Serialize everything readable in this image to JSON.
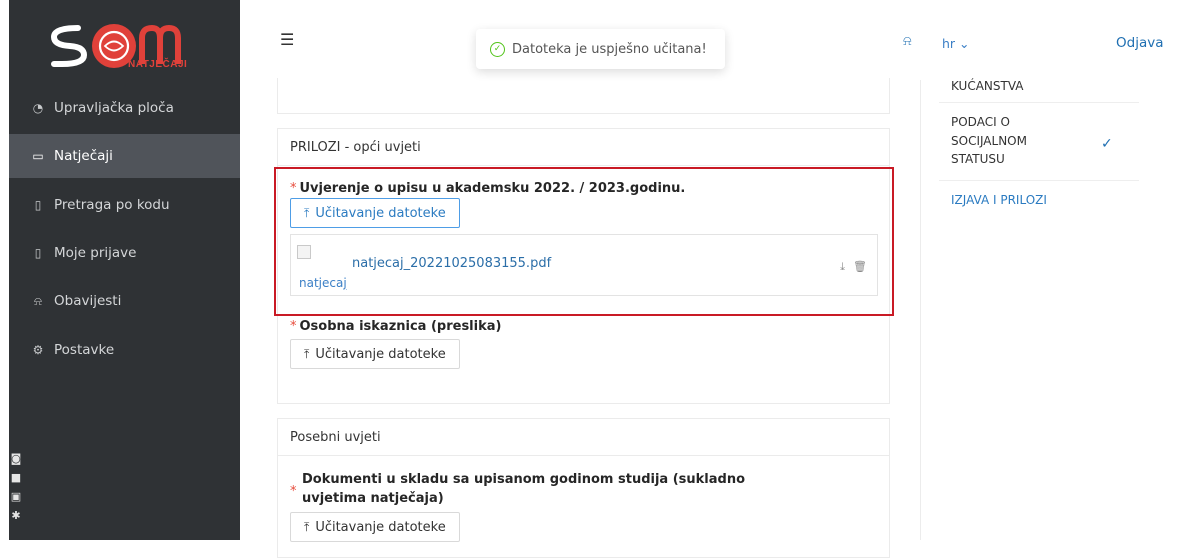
{
  "brand": {
    "logo_text": "SOM",
    "logo_sub": "NATJEČAJI",
    "colors": {
      "accent": "#e0413a",
      "sidebar": "#2f3235",
      "link": "#2b7bc1"
    }
  },
  "sidebar": {
    "items": [
      {
        "label": "Upravljačka ploča",
        "icon": "dashboard-icon"
      },
      {
        "label": "Natječaji",
        "icon": "folder-open-icon",
        "active": true
      },
      {
        "label": "Pretraga po kodu",
        "icon": "file-icon"
      },
      {
        "label": "Moje prijave",
        "icon": "file-icon"
      },
      {
        "label": "Obavijesti",
        "icon": "bell-icon"
      },
      {
        "label": "Postavke",
        "icon": "gear-icon"
      }
    ]
  },
  "topbar": {
    "language": "hr",
    "logout_label": "Odjava"
  },
  "toast": {
    "message": "Datoteka je uspješno učitana!"
  },
  "sections": [
    {
      "title": "PRILOZI - opći uvjeti",
      "fields": [
        {
          "label": "Uvjerenje o upisu u akademsku 2022. / 2023.godinu.",
          "upload_label": "Učitavanje datoteke",
          "file": {
            "name": "natjecaj_20221025083155.pdf",
            "thumb_alt": "natjecaj_20221025083155.pdf"
          }
        },
        {
          "label": "Osobna iskaznica (preslika)",
          "upload_label": "Učitavanje datoteke"
        }
      ]
    },
    {
      "title": "Posebni uvjeti",
      "fields": [
        {
          "label_line1": "Dokumenti u skladu sa upisanom godinom studija (sukladno",
          "label_line2": "uvjetima natječaja)",
          "upload_label": "Učitavanje datoteke"
        }
      ]
    }
  ],
  "steps": [
    {
      "label": "KUĆANSTVA"
    },
    {
      "label_lines": [
        "PODACI O",
        "SOCIJALNOM",
        "STATUSU"
      ],
      "completed": true
    },
    {
      "label": "IZJAVA I PRILOZI",
      "current": true
    }
  ]
}
